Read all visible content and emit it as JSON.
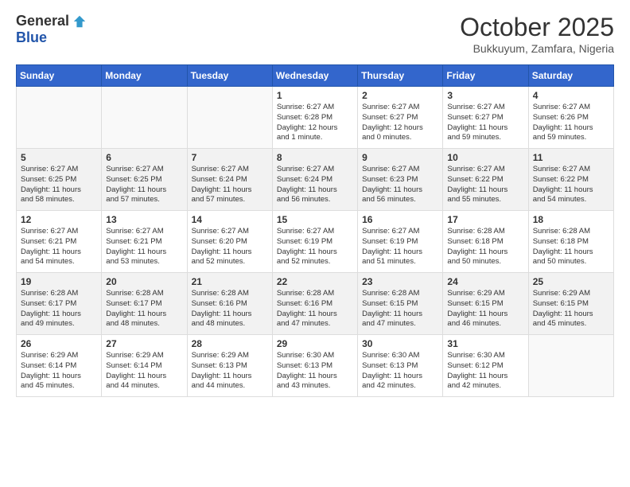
{
  "logo": {
    "general": "General",
    "blue": "Blue"
  },
  "title": "October 2025",
  "subtitle": "Bukkuyum, Zamfara, Nigeria",
  "days_header": [
    "Sunday",
    "Monday",
    "Tuesday",
    "Wednesday",
    "Thursday",
    "Friday",
    "Saturday"
  ],
  "weeks": [
    [
      {
        "day": "",
        "info": ""
      },
      {
        "day": "",
        "info": ""
      },
      {
        "day": "",
        "info": ""
      },
      {
        "day": "1",
        "info": "Sunrise: 6:27 AM\nSunset: 6:28 PM\nDaylight: 12 hours\nand 1 minute."
      },
      {
        "day": "2",
        "info": "Sunrise: 6:27 AM\nSunset: 6:27 PM\nDaylight: 12 hours\nand 0 minutes."
      },
      {
        "day": "3",
        "info": "Sunrise: 6:27 AM\nSunset: 6:27 PM\nDaylight: 11 hours\nand 59 minutes."
      },
      {
        "day": "4",
        "info": "Sunrise: 6:27 AM\nSunset: 6:26 PM\nDaylight: 11 hours\nand 59 minutes."
      }
    ],
    [
      {
        "day": "5",
        "info": "Sunrise: 6:27 AM\nSunset: 6:25 PM\nDaylight: 11 hours\nand 58 minutes."
      },
      {
        "day": "6",
        "info": "Sunrise: 6:27 AM\nSunset: 6:25 PM\nDaylight: 11 hours\nand 57 minutes."
      },
      {
        "day": "7",
        "info": "Sunrise: 6:27 AM\nSunset: 6:24 PM\nDaylight: 11 hours\nand 57 minutes."
      },
      {
        "day": "8",
        "info": "Sunrise: 6:27 AM\nSunset: 6:24 PM\nDaylight: 11 hours\nand 56 minutes."
      },
      {
        "day": "9",
        "info": "Sunrise: 6:27 AM\nSunset: 6:23 PM\nDaylight: 11 hours\nand 56 minutes."
      },
      {
        "day": "10",
        "info": "Sunrise: 6:27 AM\nSunset: 6:22 PM\nDaylight: 11 hours\nand 55 minutes."
      },
      {
        "day": "11",
        "info": "Sunrise: 6:27 AM\nSunset: 6:22 PM\nDaylight: 11 hours\nand 54 minutes."
      }
    ],
    [
      {
        "day": "12",
        "info": "Sunrise: 6:27 AM\nSunset: 6:21 PM\nDaylight: 11 hours\nand 54 minutes."
      },
      {
        "day": "13",
        "info": "Sunrise: 6:27 AM\nSunset: 6:21 PM\nDaylight: 11 hours\nand 53 minutes."
      },
      {
        "day": "14",
        "info": "Sunrise: 6:27 AM\nSunset: 6:20 PM\nDaylight: 11 hours\nand 52 minutes."
      },
      {
        "day": "15",
        "info": "Sunrise: 6:27 AM\nSunset: 6:19 PM\nDaylight: 11 hours\nand 52 minutes."
      },
      {
        "day": "16",
        "info": "Sunrise: 6:27 AM\nSunset: 6:19 PM\nDaylight: 11 hours\nand 51 minutes."
      },
      {
        "day": "17",
        "info": "Sunrise: 6:28 AM\nSunset: 6:18 PM\nDaylight: 11 hours\nand 50 minutes."
      },
      {
        "day": "18",
        "info": "Sunrise: 6:28 AM\nSunset: 6:18 PM\nDaylight: 11 hours\nand 50 minutes."
      }
    ],
    [
      {
        "day": "19",
        "info": "Sunrise: 6:28 AM\nSunset: 6:17 PM\nDaylight: 11 hours\nand 49 minutes."
      },
      {
        "day": "20",
        "info": "Sunrise: 6:28 AM\nSunset: 6:17 PM\nDaylight: 11 hours\nand 48 minutes."
      },
      {
        "day": "21",
        "info": "Sunrise: 6:28 AM\nSunset: 6:16 PM\nDaylight: 11 hours\nand 48 minutes."
      },
      {
        "day": "22",
        "info": "Sunrise: 6:28 AM\nSunset: 6:16 PM\nDaylight: 11 hours\nand 47 minutes."
      },
      {
        "day": "23",
        "info": "Sunrise: 6:28 AM\nSunset: 6:15 PM\nDaylight: 11 hours\nand 47 minutes."
      },
      {
        "day": "24",
        "info": "Sunrise: 6:29 AM\nSunset: 6:15 PM\nDaylight: 11 hours\nand 46 minutes."
      },
      {
        "day": "25",
        "info": "Sunrise: 6:29 AM\nSunset: 6:15 PM\nDaylight: 11 hours\nand 45 minutes."
      }
    ],
    [
      {
        "day": "26",
        "info": "Sunrise: 6:29 AM\nSunset: 6:14 PM\nDaylight: 11 hours\nand 45 minutes."
      },
      {
        "day": "27",
        "info": "Sunrise: 6:29 AM\nSunset: 6:14 PM\nDaylight: 11 hours\nand 44 minutes."
      },
      {
        "day": "28",
        "info": "Sunrise: 6:29 AM\nSunset: 6:13 PM\nDaylight: 11 hours\nand 44 minutes."
      },
      {
        "day": "29",
        "info": "Sunrise: 6:30 AM\nSunset: 6:13 PM\nDaylight: 11 hours\nand 43 minutes."
      },
      {
        "day": "30",
        "info": "Sunrise: 6:30 AM\nSunset: 6:13 PM\nDaylight: 11 hours\nand 42 minutes."
      },
      {
        "day": "31",
        "info": "Sunrise: 6:30 AM\nSunset: 6:12 PM\nDaylight: 11 hours\nand 42 minutes."
      },
      {
        "day": "",
        "info": ""
      }
    ]
  ]
}
